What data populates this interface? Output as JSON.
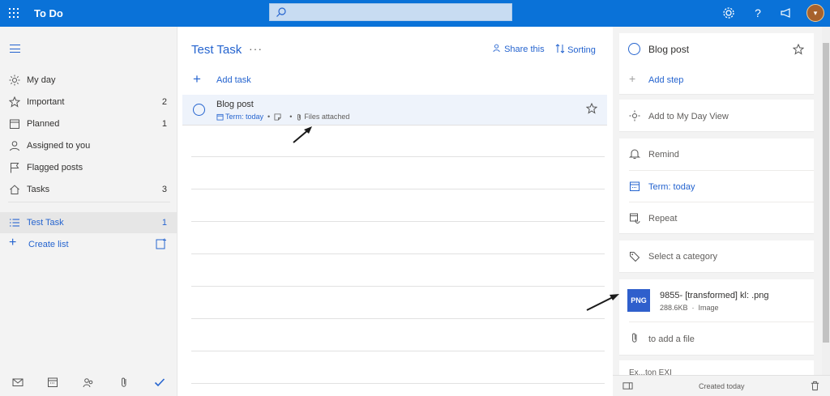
{
  "app": {
    "title": "To Do"
  },
  "search": {
    "placeholder": ""
  },
  "topbar_icons": [
    "gear-icon",
    "help-icon",
    "megaphone-icon"
  ],
  "sidebar": {
    "items": [
      {
        "label": "My day",
        "count": "",
        "icon": "sun-icon"
      },
      {
        "label": "Important",
        "count": "2",
        "icon": "star-icon"
      },
      {
        "label": "Planned",
        "count": "1",
        "icon": "calendar-icon"
      },
      {
        "label": "Assigned to you",
        "count": "",
        "icon": "person-icon"
      },
      {
        "label": "Flagged posts",
        "count": "",
        "icon": "flag-icon"
      },
      {
        "label": "Tasks",
        "count": "3",
        "icon": "home-icon"
      }
    ],
    "lists": [
      {
        "label": "Test Task",
        "count": "1",
        "icon": "list-icon"
      }
    ],
    "create_list_label": "Create list"
  },
  "main": {
    "list_title": "Test Task",
    "more_label": "···",
    "share_label": "Share this",
    "sorting_label": "Sorting",
    "add_task_label": "Add task",
    "task": {
      "title": "Blog post",
      "term": "Term: today",
      "files": "Files attached"
    }
  },
  "detail": {
    "task_title": "Blog post",
    "add_step_label": "Add step",
    "add_myday_label": "Add to My Day View",
    "remind_label": "Remind",
    "term_label": "Term: today",
    "repeat_label": "Repeat",
    "category_label": "Select a category",
    "file": {
      "badge": "PNG",
      "name": "9855- [transformed] kl: .png",
      "size": "288.6KB",
      "type": "Image"
    },
    "add_file_label": "to add a file",
    "cut_label": "Ex...ton EXI",
    "created_label": "Created today"
  },
  "colors": {
    "accent": "#2564cf",
    "topbar": "#0a72d8"
  }
}
